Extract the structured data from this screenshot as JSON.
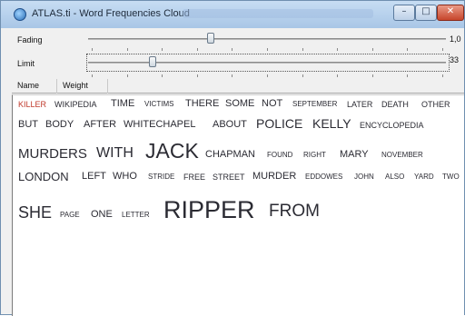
{
  "window": {
    "title": "ATLAS.ti - Word Frequencies Cloud",
    "min_glyph": "–",
    "max_glyph": "□",
    "close_glyph": "✕"
  },
  "controls": {
    "fading_label": "Fading",
    "fading_value": "1,0",
    "fading_level": 0.33,
    "limit_label": "Limit",
    "limit_value": "33",
    "limit_level": 0.17
  },
  "tabs": [
    "Name",
    "Weight"
  ],
  "colors": {
    "highlight": "#c0392b",
    "word": "#2b2b33"
  },
  "words": [
    {
      "text": "KILLER",
      "s": 9,
      "hl": true
    },
    {
      "text": "WIKIPEDIA",
      "s": 9
    },
    {
      "text": "TIME",
      "s": 11
    },
    {
      "text": "VICTIMS",
      "s": 8
    },
    {
      "text": "THERE",
      "s": 11
    },
    {
      "text": "SOME",
      "s": 11
    },
    {
      "text": "NOT",
      "s": 11
    },
    {
      "text": "SEPTEMBER",
      "s": 8
    },
    {
      "text": "LATER",
      "s": 9
    },
    {
      "text": "DEATH",
      "s": 9
    },
    {
      "text": "OTHER",
      "s": 9
    },
    {
      "text": "BUT",
      "s": 11
    },
    {
      "text": "BODY",
      "s": 11
    },
    {
      "text": "AFTER",
      "s": 11
    },
    {
      "text": "WHITECHAPEL",
      "s": 11
    },
    {
      "text": "ABOUT",
      "s": 11
    },
    {
      "text": "POLICE",
      "s": 14
    },
    {
      "text": "KELLY",
      "s": 14
    },
    {
      "text": "ENCYCLOPEDIA",
      "s": 9
    },
    {
      "text": "MURDERS",
      "s": 15
    },
    {
      "text": "WITH",
      "s": 16
    },
    {
      "text": "JACK",
      "s": 23
    },
    {
      "text": "CHAPMAN",
      "s": 11
    },
    {
      "text": "FOUND",
      "s": 8
    },
    {
      "text": "RIGHT",
      "s": 8
    },
    {
      "text": "MARY",
      "s": 11
    },
    {
      "text": "NOVEMBER",
      "s": 8
    },
    {
      "text": "LONDON",
      "s": 13
    },
    {
      "text": "LEFT",
      "s": 11
    },
    {
      "text": "WHO",
      "s": 11
    },
    {
      "text": "STRIDE",
      "s": 8
    },
    {
      "text": "FREE",
      "s": 9
    },
    {
      "text": "STREET",
      "s": 9
    },
    {
      "text": "MURDER",
      "s": 11
    },
    {
      "text": "EDDOWES",
      "s": 8
    },
    {
      "text": "JOHN",
      "s": 8
    },
    {
      "text": "ALSO",
      "s": 8
    },
    {
      "text": "YARD",
      "s": 8
    },
    {
      "text": "TWO",
      "s": 8
    },
    {
      "text": "SHE",
      "s": 18
    },
    {
      "text": "PAGE",
      "s": 8
    },
    {
      "text": "ONE",
      "s": 11
    },
    {
      "text": "LETTER",
      "s": 8
    },
    {
      "text": "RIPPER",
      "s": 27
    },
    {
      "text": "FROM",
      "s": 19
    }
  ]
}
